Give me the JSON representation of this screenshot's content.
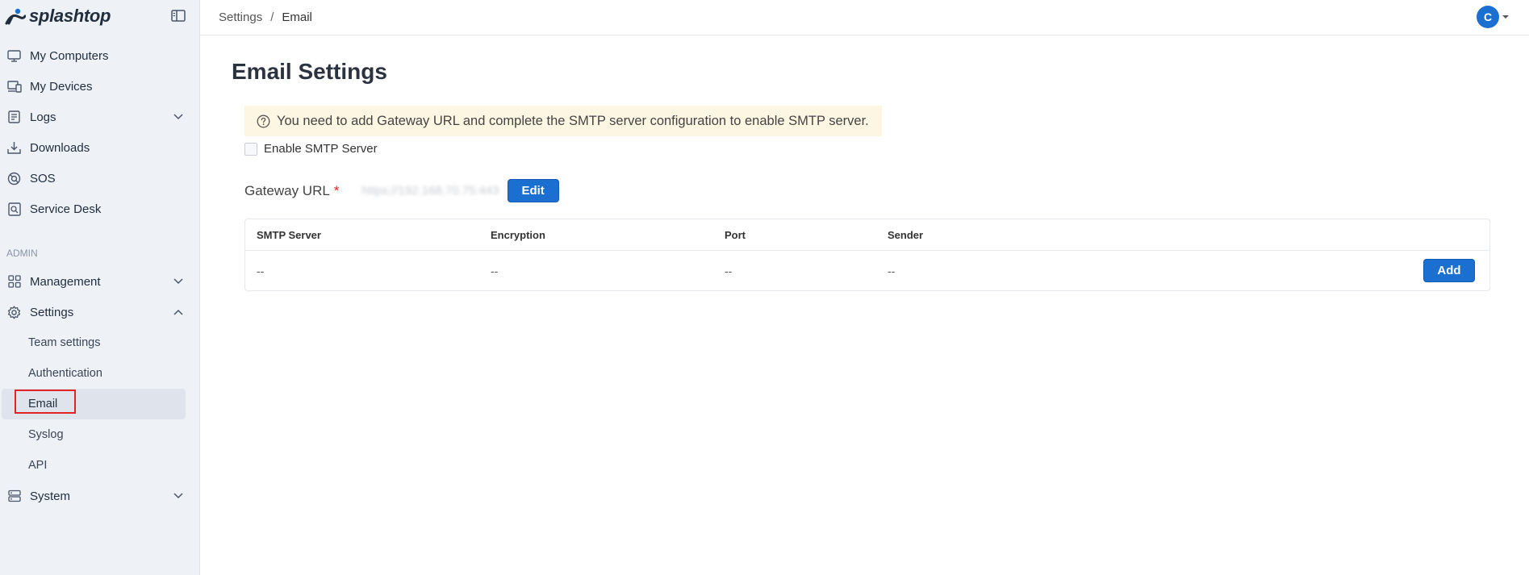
{
  "brand": {
    "name": "splashtop",
    "mark": "®"
  },
  "topbar": {
    "breadcrumb": [
      "Settings",
      "Email"
    ],
    "separator": "/",
    "avatar_initial": "C"
  },
  "sidebar": {
    "items": [
      {
        "label": "My Computers",
        "icon": "monitor-icon"
      },
      {
        "label": "My Devices",
        "icon": "devices-icon"
      },
      {
        "label": "Logs",
        "icon": "logs-icon",
        "expandable": true
      },
      {
        "label": "Downloads",
        "icon": "download-icon"
      },
      {
        "label": "SOS",
        "icon": "sos-icon"
      },
      {
        "label": "Service Desk",
        "icon": "service-desk-icon"
      }
    ],
    "admin_label": "ADMIN",
    "admin_items": [
      {
        "label": "Management",
        "icon": "grid-icon",
        "expanded": false
      },
      {
        "label": "Settings",
        "icon": "gear-icon",
        "expanded": true
      }
    ],
    "settings_subitems": [
      "Team settings",
      "Authentication",
      "Email",
      "Syslog",
      "API"
    ],
    "active_subitem": "Email",
    "system_item": {
      "label": "System",
      "icon": "server-icon"
    }
  },
  "main": {
    "title": "Email Settings",
    "notice": "You need to add Gateway URL and complete the SMTP server configuration to enable SMTP server.",
    "enable_smtp_label": "Enable SMTP Server",
    "gateway_label": "Gateway URL",
    "gateway_required": "*",
    "gateway_value": "https://192.168.70.75:443",
    "edit_label": "Edit",
    "table": {
      "columns": [
        "SMTP Server",
        "Encryption",
        "Port",
        "Sender"
      ],
      "rows": [
        [
          "--",
          "--",
          "--",
          "--"
        ]
      ],
      "add_label": "Add"
    }
  },
  "colors": {
    "accent": "#1b6fd1",
    "notice_bg": "#fdf6e3",
    "sidebar_bg": "#eef1f6",
    "highlight_border": "#e02424"
  }
}
